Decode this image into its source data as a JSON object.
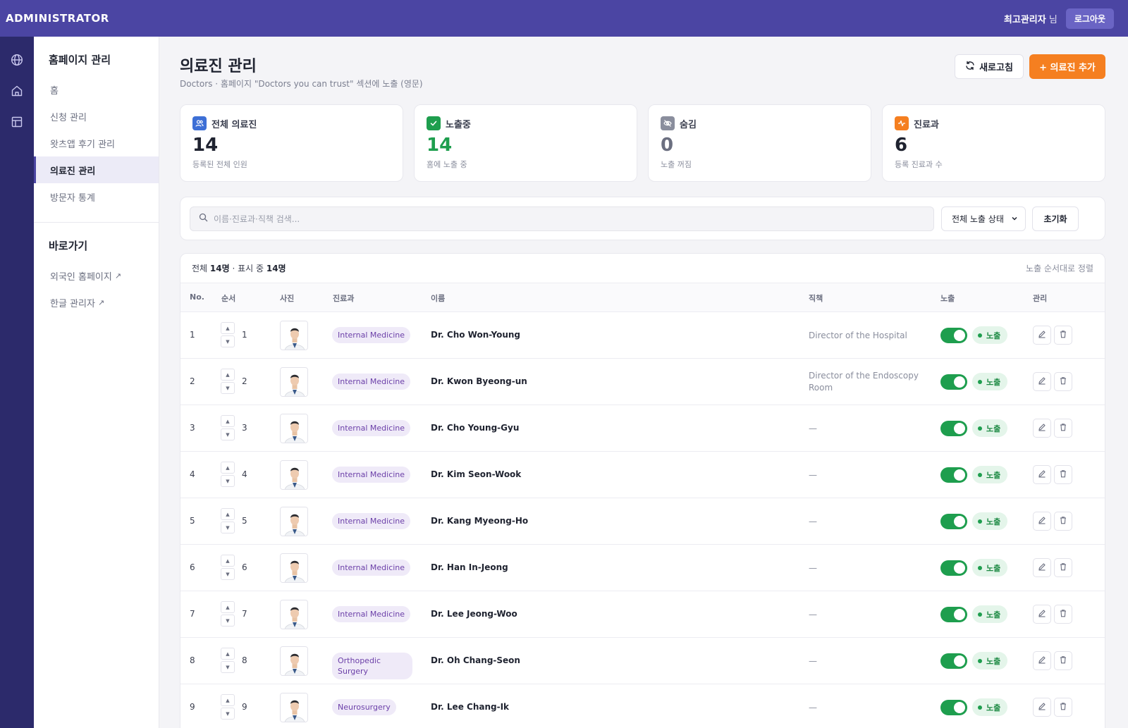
{
  "topbar": {
    "brand": "ADMINISTRATOR",
    "user_name": "최고관리자",
    "user_suffix": " 님",
    "logout": "로그아웃"
  },
  "rail": {
    "icons": [
      "globe-icon",
      "home-icon",
      "layout-icon"
    ]
  },
  "sidebar": {
    "section1_title": "홈페이지 관리",
    "items": [
      {
        "label": "홈",
        "active": false
      },
      {
        "label": "신청 관리",
        "active": false
      },
      {
        "label": "왓츠앱 후기 관리",
        "active": false
      },
      {
        "label": "의료진 관리",
        "active": true
      },
      {
        "label": "방문자 통계",
        "active": false
      }
    ],
    "section2_title": "바로가기",
    "links": [
      {
        "label": "외국인 홈페이지",
        "ext": "↗"
      },
      {
        "label": "한글 관리자",
        "ext": "↗"
      }
    ]
  },
  "header": {
    "title": "의료진 관리",
    "subtitle": "Doctors · 홈페이지 \"Doctors you can trust\" 섹션에 노출 (영문)",
    "refresh": "새로고침",
    "add": "+ 의료진 추가"
  },
  "stats": [
    {
      "label": "전체 의료진",
      "value": "14",
      "desc": "등록된 전체 인원",
      "icon": "users-icon",
      "icon_bg": "#3d6fd6",
      "value_color": "#1f2330"
    },
    {
      "label": "노출중",
      "value": "14",
      "desc": "홈에 노출 중",
      "icon": "check-icon",
      "icon_bg": "#1e9e4e",
      "value_color": "#1e9e4e"
    },
    {
      "label": "숨김",
      "value": "0",
      "desc": "노출 꺼짐",
      "icon": "eye-off-icon",
      "icon_bg": "#8a8e9d",
      "value_color": "#6b6f80"
    },
    {
      "label": "진료과",
      "value": "6",
      "desc": "등록 진료과 수",
      "icon": "pulse-icon",
      "icon_bg": "#f57f20",
      "value_color": "#1f2330"
    }
  ],
  "filter": {
    "search_placeholder": "이름·진료과·직책 검색...",
    "status_select": "전체 노출 상태",
    "reset": "초기화"
  },
  "table": {
    "count_prefix": "전체 ",
    "count_total": "14명",
    "count_mid": " · 표시 중 ",
    "count_shown": "14명",
    "sort_label": "노출 순서대로 정렬",
    "columns": {
      "no": "No.",
      "order": "순서",
      "photo": "사진",
      "dept": "진료과",
      "name": "이름",
      "title": "직책",
      "visible": "노출",
      "manage": "관리"
    },
    "badge_label": "노출",
    "rows": [
      {
        "no": "1",
        "order": "1",
        "dept": "Internal Medicine",
        "name": "Dr. Cho Won-Young",
        "title": "Director of the Hospital"
      },
      {
        "no": "2",
        "order": "2",
        "dept": "Internal Medicine",
        "name": "Dr. Kwon Byeong-un",
        "title": "Director of the Endoscopy Room"
      },
      {
        "no": "3",
        "order": "3",
        "dept": "Internal Medicine",
        "name": "Dr. Cho Young-Gyu",
        "title": "—"
      },
      {
        "no": "4",
        "order": "4",
        "dept": "Internal Medicine",
        "name": "Dr. Kim Seon-Wook",
        "title": "—"
      },
      {
        "no": "5",
        "order": "5",
        "dept": "Internal Medicine",
        "name": "Dr. Kang Myeong-Ho",
        "title": "—"
      },
      {
        "no": "6",
        "order": "6",
        "dept": "Internal Medicine",
        "name": "Dr. Han In-Jeong",
        "title": "—"
      },
      {
        "no": "7",
        "order": "7",
        "dept": "Internal Medicine",
        "name": "Dr. Lee Jeong-Woo",
        "title": "—"
      },
      {
        "no": "8",
        "order": "8",
        "dept": "Orthopedic Surgery",
        "name": "Dr. Oh Chang-Seon",
        "title": "—"
      },
      {
        "no": "9",
        "order": "9",
        "dept": "Neurosurgery",
        "name": "Dr. Lee Chang-Ik",
        "title": "—"
      }
    ]
  }
}
